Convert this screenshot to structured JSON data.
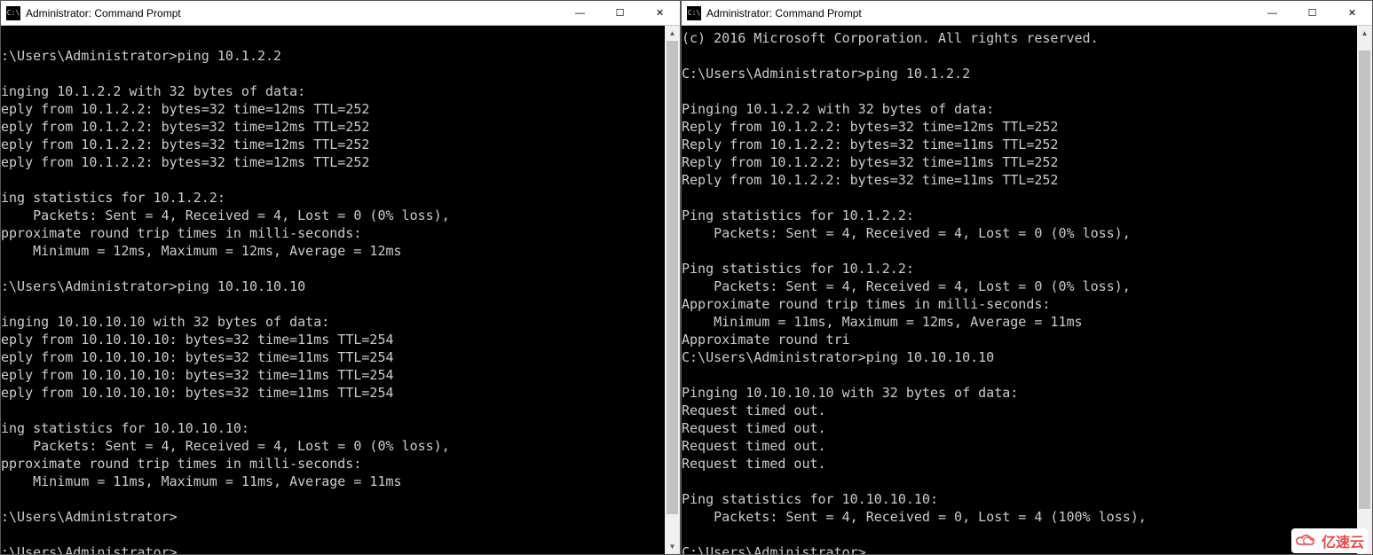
{
  "windows": [
    {
      "titlebar": {
        "icon_label": "C:\\",
        "title": "Administrator: Command Prompt",
        "min_glyph": "—",
        "max_glyph": "☐",
        "close_glyph": "✕"
      },
      "scrollbar": {
        "up": "▲",
        "down": "▼",
        "thumb_top": "0%",
        "thumb_height": "95%"
      },
      "lines": [
        "",
        ":\\Users\\Administrator>ping 10.1.2.2",
        "",
        "inging 10.1.2.2 with 32 bytes of data:",
        "eply from 10.1.2.2: bytes=32 time=12ms TTL=252",
        "eply from 10.1.2.2: bytes=32 time=12ms TTL=252",
        "eply from 10.1.2.2: bytes=32 time=12ms TTL=252",
        "eply from 10.1.2.2: bytes=32 time=12ms TTL=252",
        "",
        "ing statistics for 10.1.2.2:",
        "    Packets: Sent = 4, Received = 4, Lost = 0 (0% loss),",
        "pproximate round trip times in milli-seconds:",
        "    Minimum = 12ms, Maximum = 12ms, Average = 12ms",
        "",
        ":\\Users\\Administrator>ping 10.10.10.10",
        "",
        "inging 10.10.10.10 with 32 bytes of data:",
        "eply from 10.10.10.10: bytes=32 time=11ms TTL=254",
        "eply from 10.10.10.10: bytes=32 time=11ms TTL=254",
        "eply from 10.10.10.10: bytes=32 time=11ms TTL=254",
        "eply from 10.10.10.10: bytes=32 time=11ms TTL=254",
        "",
        "ing statistics for 10.10.10.10:",
        "    Packets: Sent = 4, Received = 4, Lost = 0 (0% loss),",
        "pproximate round trip times in milli-seconds:",
        "    Minimum = 11ms, Maximum = 11ms, Average = 11ms",
        "",
        ":\\Users\\Administrator>",
        "",
        ":\\Users\\Administrator>"
      ],
      "show_cursor": true
    },
    {
      "titlebar": {
        "icon_label": "C:\\",
        "title": "Administrator: Command Prompt",
        "min_glyph": "—",
        "max_glyph": "☐",
        "close_glyph": "✕"
      },
      "scrollbar": {
        "up": "▲",
        "down": "▼",
        "thumb_top": "2%",
        "thumb_height": "92%"
      },
      "lines": [
        "(c) 2016 Microsoft Corporation. All rights reserved.",
        "",
        "C:\\Users\\Administrator>ping 10.1.2.2",
        "",
        "Pinging 10.1.2.2 with 32 bytes of data:",
        "Reply from 10.1.2.2: bytes=32 time=12ms TTL=252",
        "Reply from 10.1.2.2: bytes=32 time=11ms TTL=252",
        "Reply from 10.1.2.2: bytes=32 time=11ms TTL=252",
        "Reply from 10.1.2.2: bytes=32 time=11ms TTL=252",
        "",
        "Ping statistics for 10.1.2.2:",
        "    Packets: Sent = 4, Received = 4, Lost = 0 (0% loss),",
        "",
        "Ping statistics for 10.1.2.2:",
        "    Packets: Sent = 4, Received = 4, Lost = 0 (0% loss),",
        "Approximate round trip times in milli-seconds:",
        "    Minimum = 11ms, Maximum = 12ms, Average = 11ms",
        "Approximate round tri",
        "C:\\Users\\Administrator>ping 10.10.10.10",
        "",
        "Pinging 10.10.10.10 with 32 bytes of data:",
        "Request timed out.",
        "Request timed out.",
        "Request timed out.",
        "Request timed out.",
        "",
        "Ping statistics for 10.10.10.10:",
        "    Packets: Sent = 4, Received = 0, Lost = 4 (100% loss),",
        "",
        "C:\\Users\\Administrator>"
      ],
      "show_cursor": false
    }
  ],
  "watermark": {
    "text": "亿速云"
  }
}
